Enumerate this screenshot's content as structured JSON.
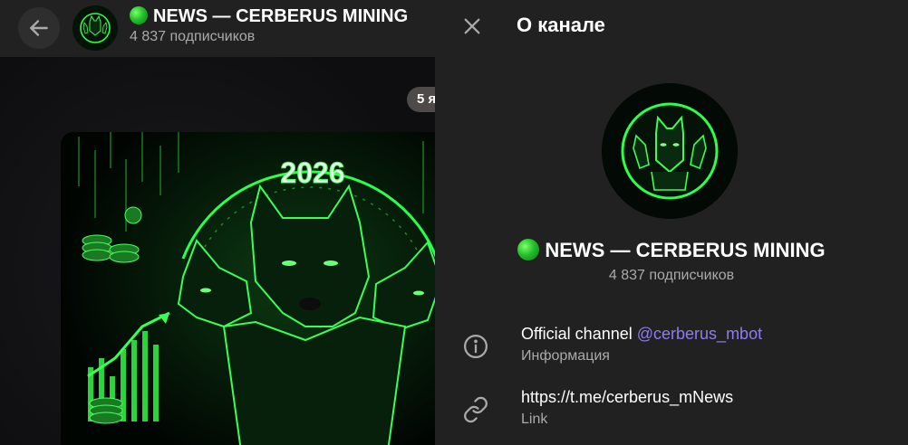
{
  "chat": {
    "header": {
      "title": "NEWS — CERBERUS MINING",
      "subscribers": "4 837 подписчиков"
    },
    "date_pill": "5 я",
    "post_image": {
      "year_text": "2026"
    }
  },
  "panel": {
    "title": "О канале",
    "channel_name": "NEWS — CERBERUS MINING",
    "subscribers": "4 837 подписчиков",
    "description": {
      "text": "Official channel ",
      "mention": "@cerberus_mbot",
      "label": "Информация"
    },
    "link": {
      "url": "https://t.me/cerberus_mNews",
      "label": "Link"
    }
  },
  "colors": {
    "accent_green": "#22c02a",
    "mention": "#8f7cf0",
    "panel_bg": "#212121",
    "muted_text": "#aaaaaa"
  },
  "icons": [
    "arrow-left-icon",
    "close-icon",
    "info-icon",
    "link-icon",
    "green-circle-icon"
  ]
}
